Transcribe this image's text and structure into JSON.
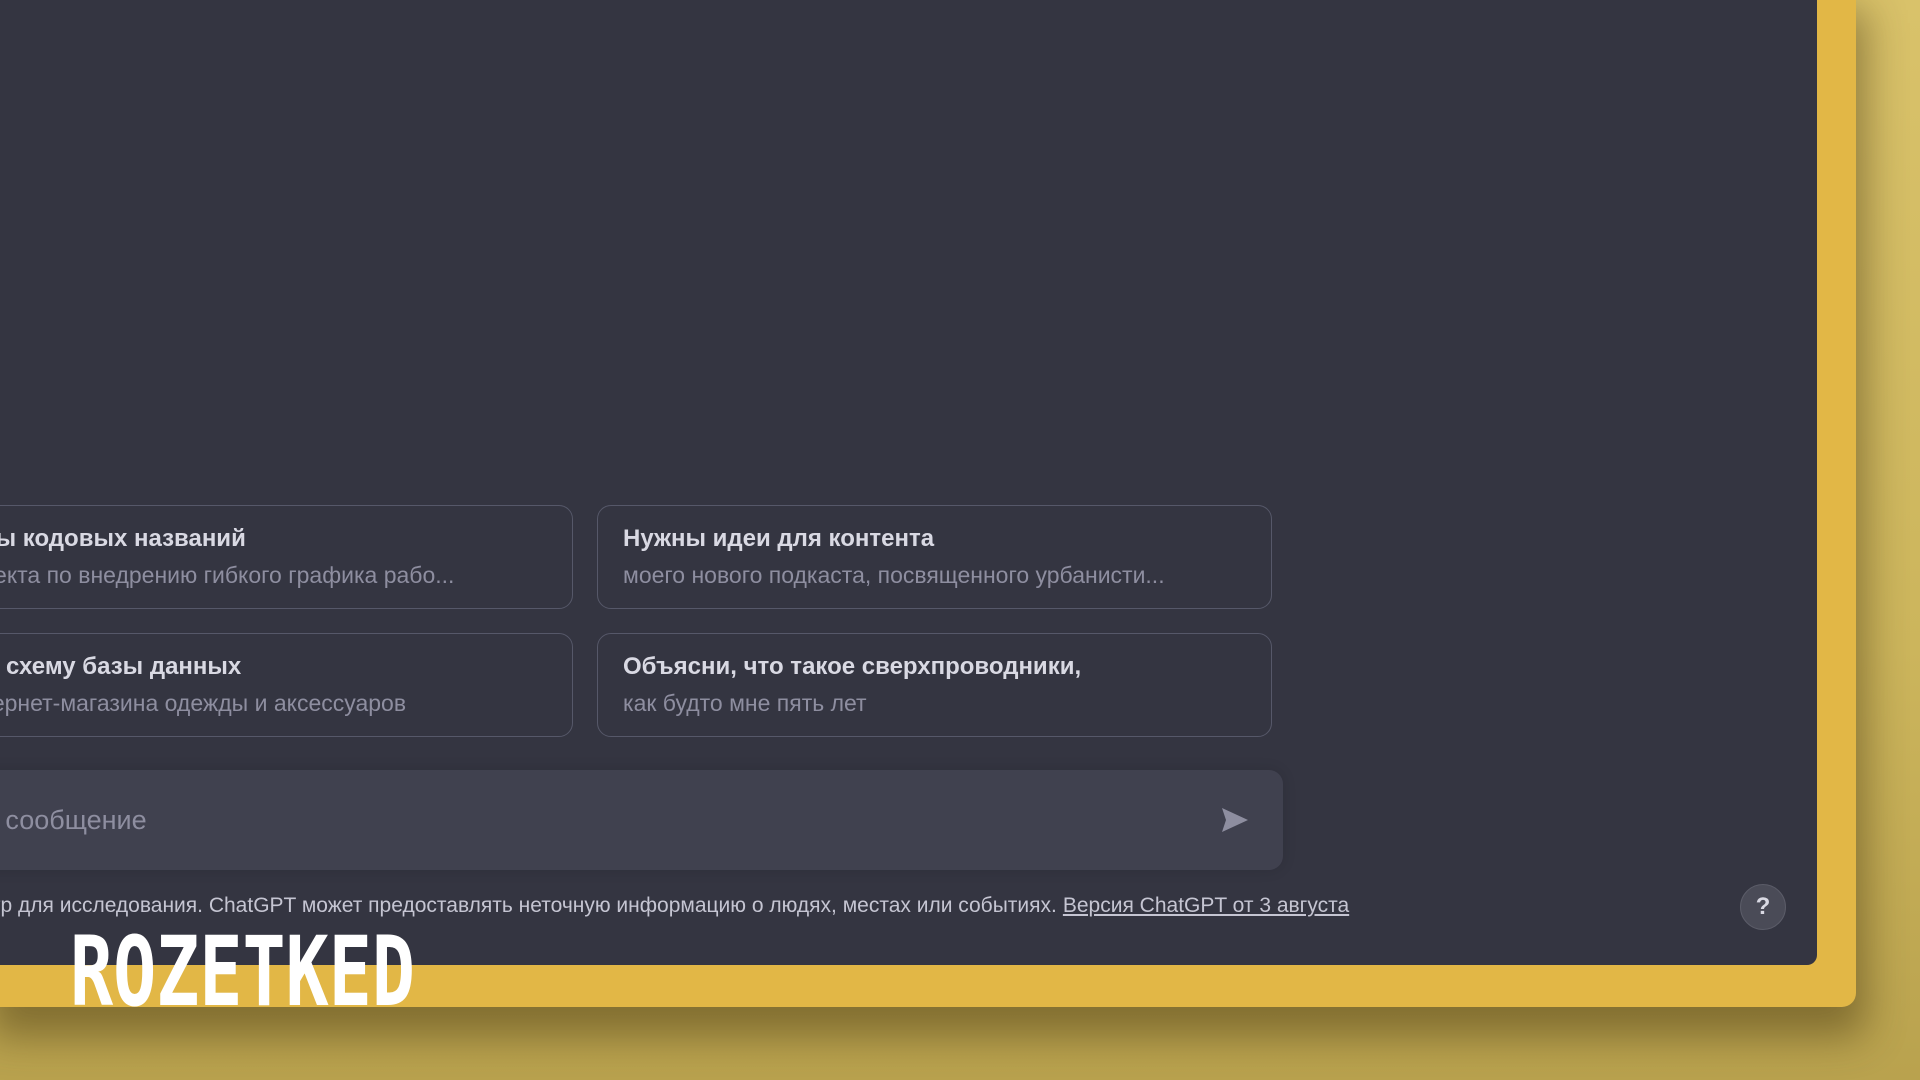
{
  "prompts": [
    {
      "title": "анты кодовых названий",
      "subtitle": "проекта по внедрению гибкого графика рабо..."
    },
    {
      "title": "Нужны идеи для контента",
      "subtitle": "моего нового подкаста, посвященного урбанисти..."
    },
    {
      "title": "дай схему базы данных",
      "subtitle": "интернет-магазина одежды и аксессуаров"
    },
    {
      "title": "Объясни, что такое сверхпроводники,",
      "subtitle": "как будто мне пять лет"
    }
  ],
  "composer": {
    "placeholder": "равить сообщение",
    "send_icon": "send-icon"
  },
  "footer": {
    "disclaimer": "просмотр для исследования. ChatGPT может предоставлять неточную информацию о людях, местах или событиях.",
    "version_link": "Версия ChatGPT от 3 августа"
  },
  "help": {
    "label": "?"
  },
  "watermark": {
    "text": "ROZETKED"
  },
  "colors": {
    "background": "#343541",
    "frame": "#e2b746",
    "composer": "#40414f",
    "card_border": "#565869"
  }
}
